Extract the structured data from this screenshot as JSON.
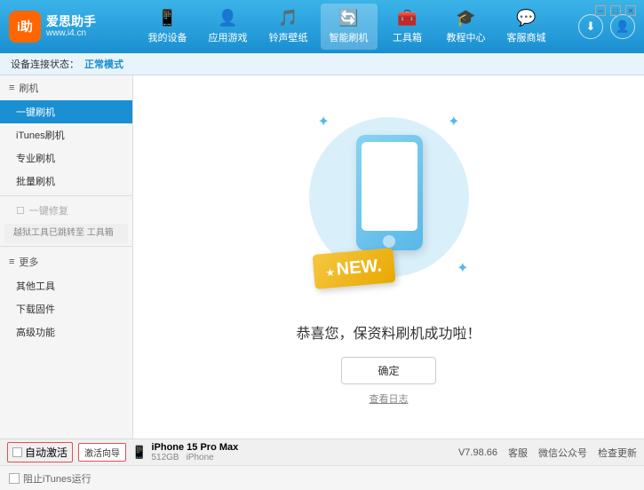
{
  "app": {
    "logo_name": "爱思助手",
    "logo_site": "www.i4.cn",
    "logo_abbr": "i助"
  },
  "nav": {
    "items": [
      {
        "label": "我的设备",
        "icon": "📱"
      },
      {
        "label": "应用游戏",
        "icon": "👤"
      },
      {
        "label": "铃声壁纸",
        "icon": "🎵"
      },
      {
        "label": "智能刷机",
        "icon": "🔄",
        "active": true
      },
      {
        "label": "工具箱",
        "icon": "🧰"
      },
      {
        "label": "教程中心",
        "icon": "🎓"
      },
      {
        "label": "客服商城",
        "icon": "💬"
      }
    ]
  },
  "status_bar": {
    "prefix": "设备连接状态：",
    "mode": "正常模式"
  },
  "sidebar": {
    "section_flash": "刷机",
    "items": [
      {
        "label": "一键刷机",
        "active": true
      },
      {
        "label": "iTunes刷机"
      },
      {
        "label": "专业刷机"
      },
      {
        "label": "批量刷机"
      }
    ],
    "section_restore": "一键修复",
    "restore_note": "越狱工具已跳转至\n工具箱",
    "section_more": "更多",
    "more_items": [
      {
        "label": "其他工具"
      },
      {
        "label": "下载固件"
      },
      {
        "label": "高级功能"
      }
    ]
  },
  "content": {
    "new_badge": "NEW.",
    "success_text": "恭喜您，保资料刷机成功啦！",
    "confirm_btn": "确定",
    "view_log": "查看日志"
  },
  "bottom": {
    "auto_activate_label": "自动激活",
    "activate_guide_label": "激活向导",
    "device_name": "iPhone 15 Pro Max",
    "device_storage": "512GB",
    "device_type": "iPhone",
    "version": "V7.98.66",
    "links": [
      {
        "label": "客服"
      },
      {
        "label": "微信公众号"
      },
      {
        "label": "检查更新"
      }
    ]
  },
  "footer": {
    "stop_itunes_label": "阻止iTunes运行"
  }
}
